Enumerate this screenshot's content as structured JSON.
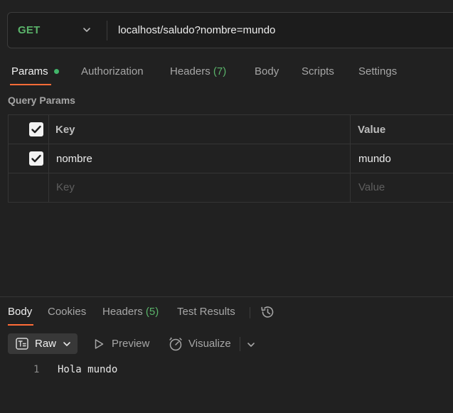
{
  "request": {
    "method": "GET",
    "url": "localhost/saludo?nombre=mundo"
  },
  "request_tabs": {
    "params": "Params",
    "authorization": "Authorization",
    "headers": "Headers",
    "headers_count": "(7)",
    "body": "Body",
    "scripts": "Scripts",
    "settings": "Settings"
  },
  "query_params": {
    "title": "Query Params",
    "key_header": "Key",
    "value_header": "Value",
    "rows": [
      {
        "checked": true,
        "key": "nombre",
        "value": "mundo"
      }
    ],
    "key_placeholder": "Key",
    "value_placeholder": "Value"
  },
  "response_tabs": {
    "body": "Body",
    "cookies": "Cookies",
    "headers": "Headers",
    "headers_count": "(5)",
    "test_results": "Test Results"
  },
  "response_view": {
    "format": "Raw",
    "preview": "Preview",
    "visualize": "Visualize"
  },
  "response_body": {
    "line_number": "1",
    "text": "Hola mundo"
  },
  "icons": {
    "method_dropdown": "chevron-down-icon",
    "params_indicator": "green-dot",
    "checkbox": "checkbox-checked-icon",
    "history": "history-icon",
    "raw": "text-document-icon",
    "preview": "play-triangle-icon",
    "visualize": "visualize-icon",
    "more": "chevron-down-icon"
  },
  "colors": {
    "accent": "#ff6c37",
    "method_get": "#5ab36a",
    "count": "#5ab36a",
    "background": "#212121"
  }
}
